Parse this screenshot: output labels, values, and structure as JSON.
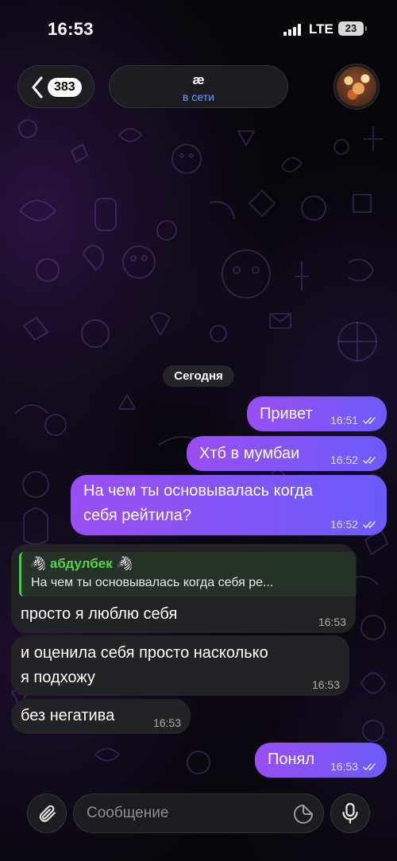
{
  "status_bar": {
    "time": "16:53",
    "network": "LTE",
    "battery": "23"
  },
  "header": {
    "back_count": "383",
    "chat_name": "æ",
    "chat_status": "в сети"
  },
  "date_separator": "Сегодня",
  "messages": [
    {
      "direction": "out",
      "text": "Привет",
      "time": "16:51",
      "read": true
    },
    {
      "direction": "out",
      "text": "Хтб в мумбаи",
      "time": "16:52",
      "read": true
    },
    {
      "direction": "out",
      "lines": [
        "На чем ты основывалась когда",
        "себя рейтила?"
      ],
      "time": "16:52",
      "read": true
    },
    {
      "direction": "in",
      "reply": {
        "name": "🦓 абдулбек 🦓",
        "text": "На чем ты основывалась когда себя ре..."
      },
      "text": "просто я люблю себя",
      "time": "16:53"
    },
    {
      "direction": "in",
      "lines": [
        "и оценила себя просто насколько",
        "я подхожу"
      ],
      "time": "16:53"
    },
    {
      "direction": "in",
      "text": "без негатива",
      "time": "16:53"
    },
    {
      "direction": "out",
      "text": "Понял",
      "time": "16:53",
      "read": true
    }
  ],
  "composer": {
    "placeholder": "Сообщение"
  },
  "icons": {
    "back": "chevron-left-icon",
    "attach": "paperclip-icon",
    "sticker": "sticker-icon",
    "mic": "microphone-icon",
    "read": "double-check-icon"
  },
  "colors": {
    "outgoing_start": "#9a4ef5",
    "outgoing_end": "#6b5bf8",
    "incoming": "#232326",
    "online_status": "#5aa0ff",
    "reply_accent": "#4ec94e"
  }
}
